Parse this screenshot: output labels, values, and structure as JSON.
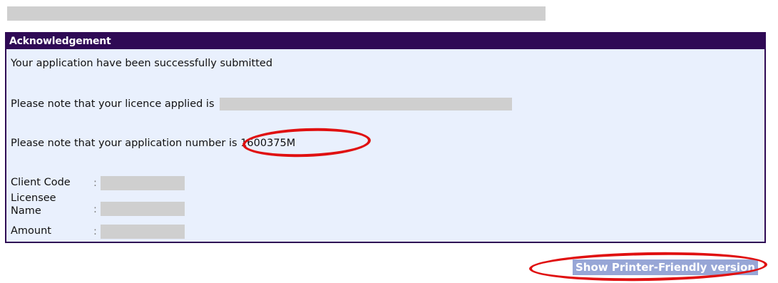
{
  "acknowledgement": {
    "title": "Acknowledgement",
    "success_message": "Your application have been successfully submitted",
    "licence_prefix": "Please note that your licence applied is",
    "application_number_text": "Please note that your application number is 1600375M"
  },
  "details": [
    {
      "label": "Client Code",
      "separator": ":"
    },
    {
      "label": "Licensee Name",
      "separator": ":"
    },
    {
      "label": "Amount",
      "separator": ":"
    }
  ],
  "printer_link": {
    "label": "Show Printer-Friendly version"
  },
  "colors": {
    "header_bg": "#2f0a55",
    "panel_bg": "#e9f0fd",
    "annotation_ring": "#e01010",
    "link_highlight": "#97a6d6"
  }
}
